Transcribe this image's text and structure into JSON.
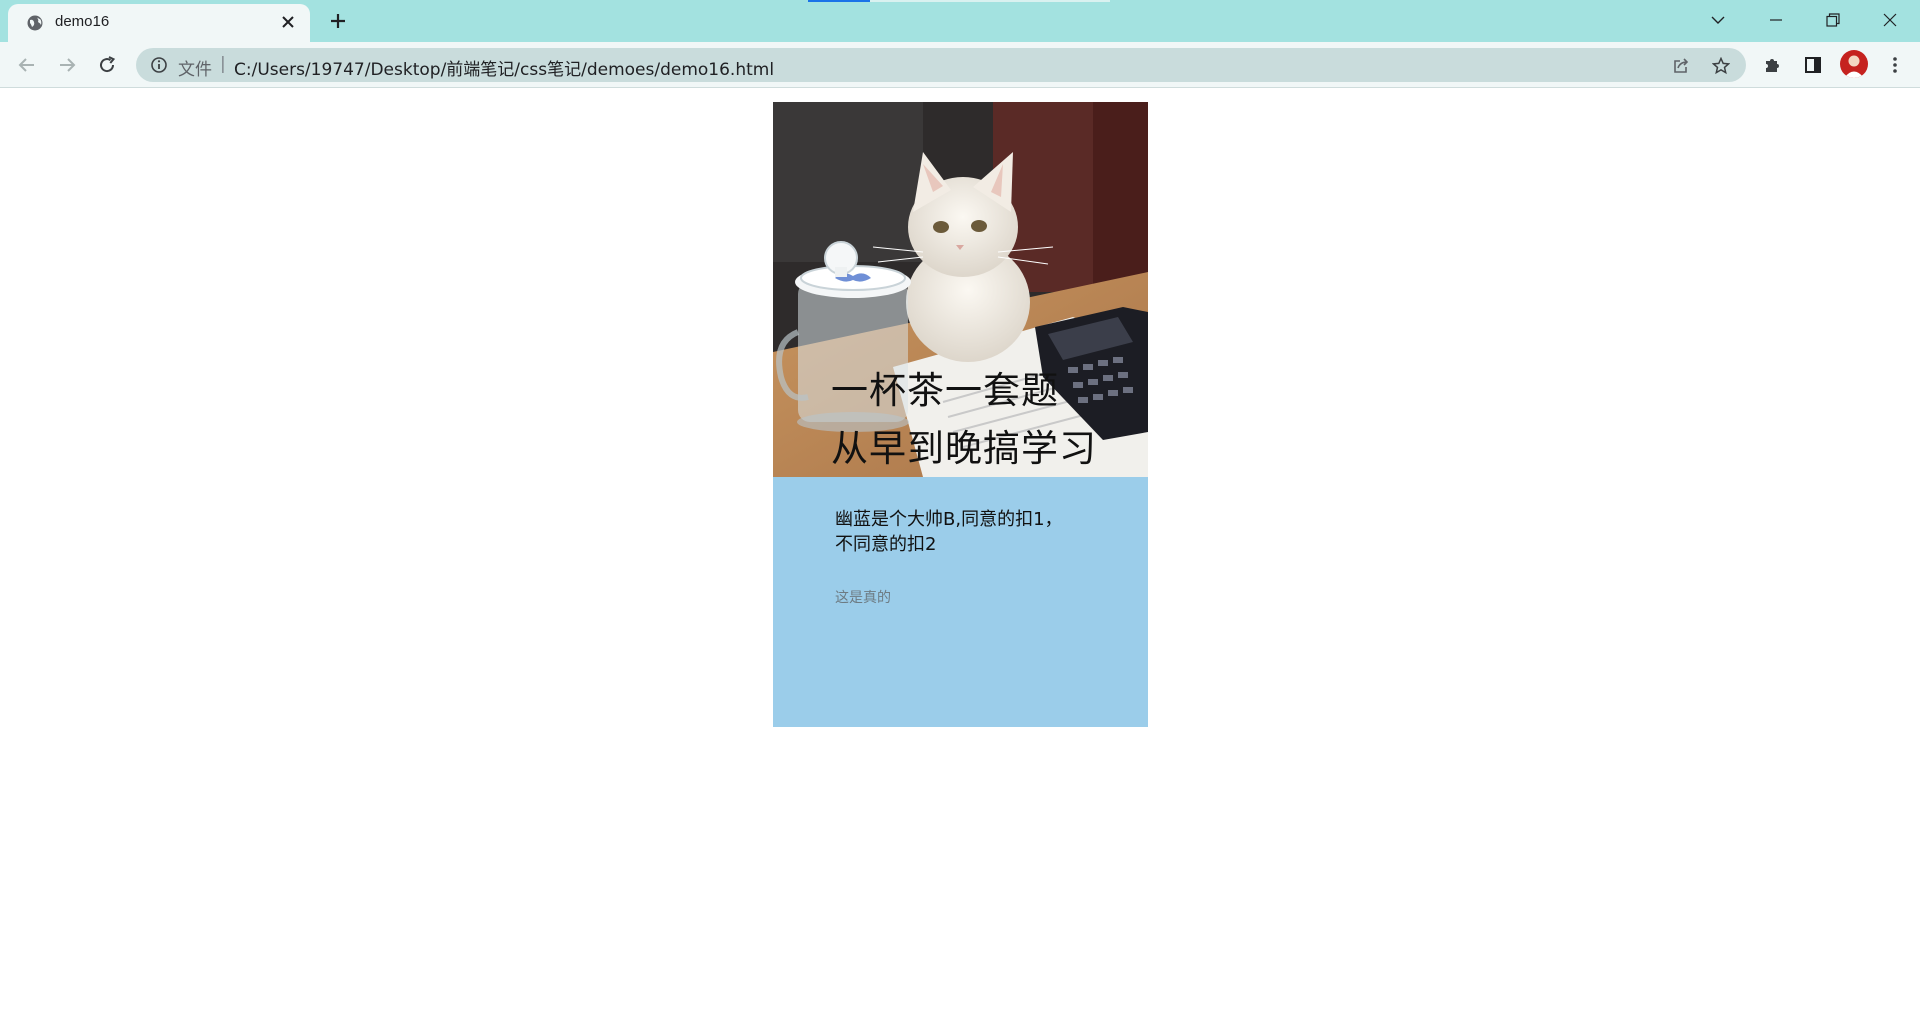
{
  "browser": {
    "tab": {
      "title": "demo16"
    },
    "address_bar": {
      "scheme_label": "文件",
      "separator": "|",
      "url": "C:/Users/19747/Desktop/前端笔记/css笔记/demoes/demo16.html"
    },
    "colors": {
      "titlebar": "#a3e2e0",
      "toolbar": "#f1f7f7",
      "omnibox": "#c9dcdc",
      "avatar": "#c5221f"
    }
  },
  "card": {
    "image_caption": [
      "一杯茶一套题",
      "从早到晚搞学习"
    ],
    "title_lines": [
      "幽蓝是个大帅B,同意的扣1，",
      "不同意的扣2"
    ],
    "note": "这是真的",
    "colors": {
      "background": "#9bcdea"
    }
  },
  "icons": {
    "tab_favicon": "globe-icon",
    "close": "close-icon",
    "new_tab": "plus-icon",
    "tab_search": "chevron-down-icon",
    "back": "arrow-left-icon",
    "forward": "arrow-right-icon",
    "reload": "reload-icon",
    "site_info": "info-icon",
    "share": "share-icon",
    "bookmark": "star-icon",
    "extensions": "puzzle-icon",
    "side_panel": "side-panel-icon",
    "menu": "kebab-menu-icon"
  }
}
